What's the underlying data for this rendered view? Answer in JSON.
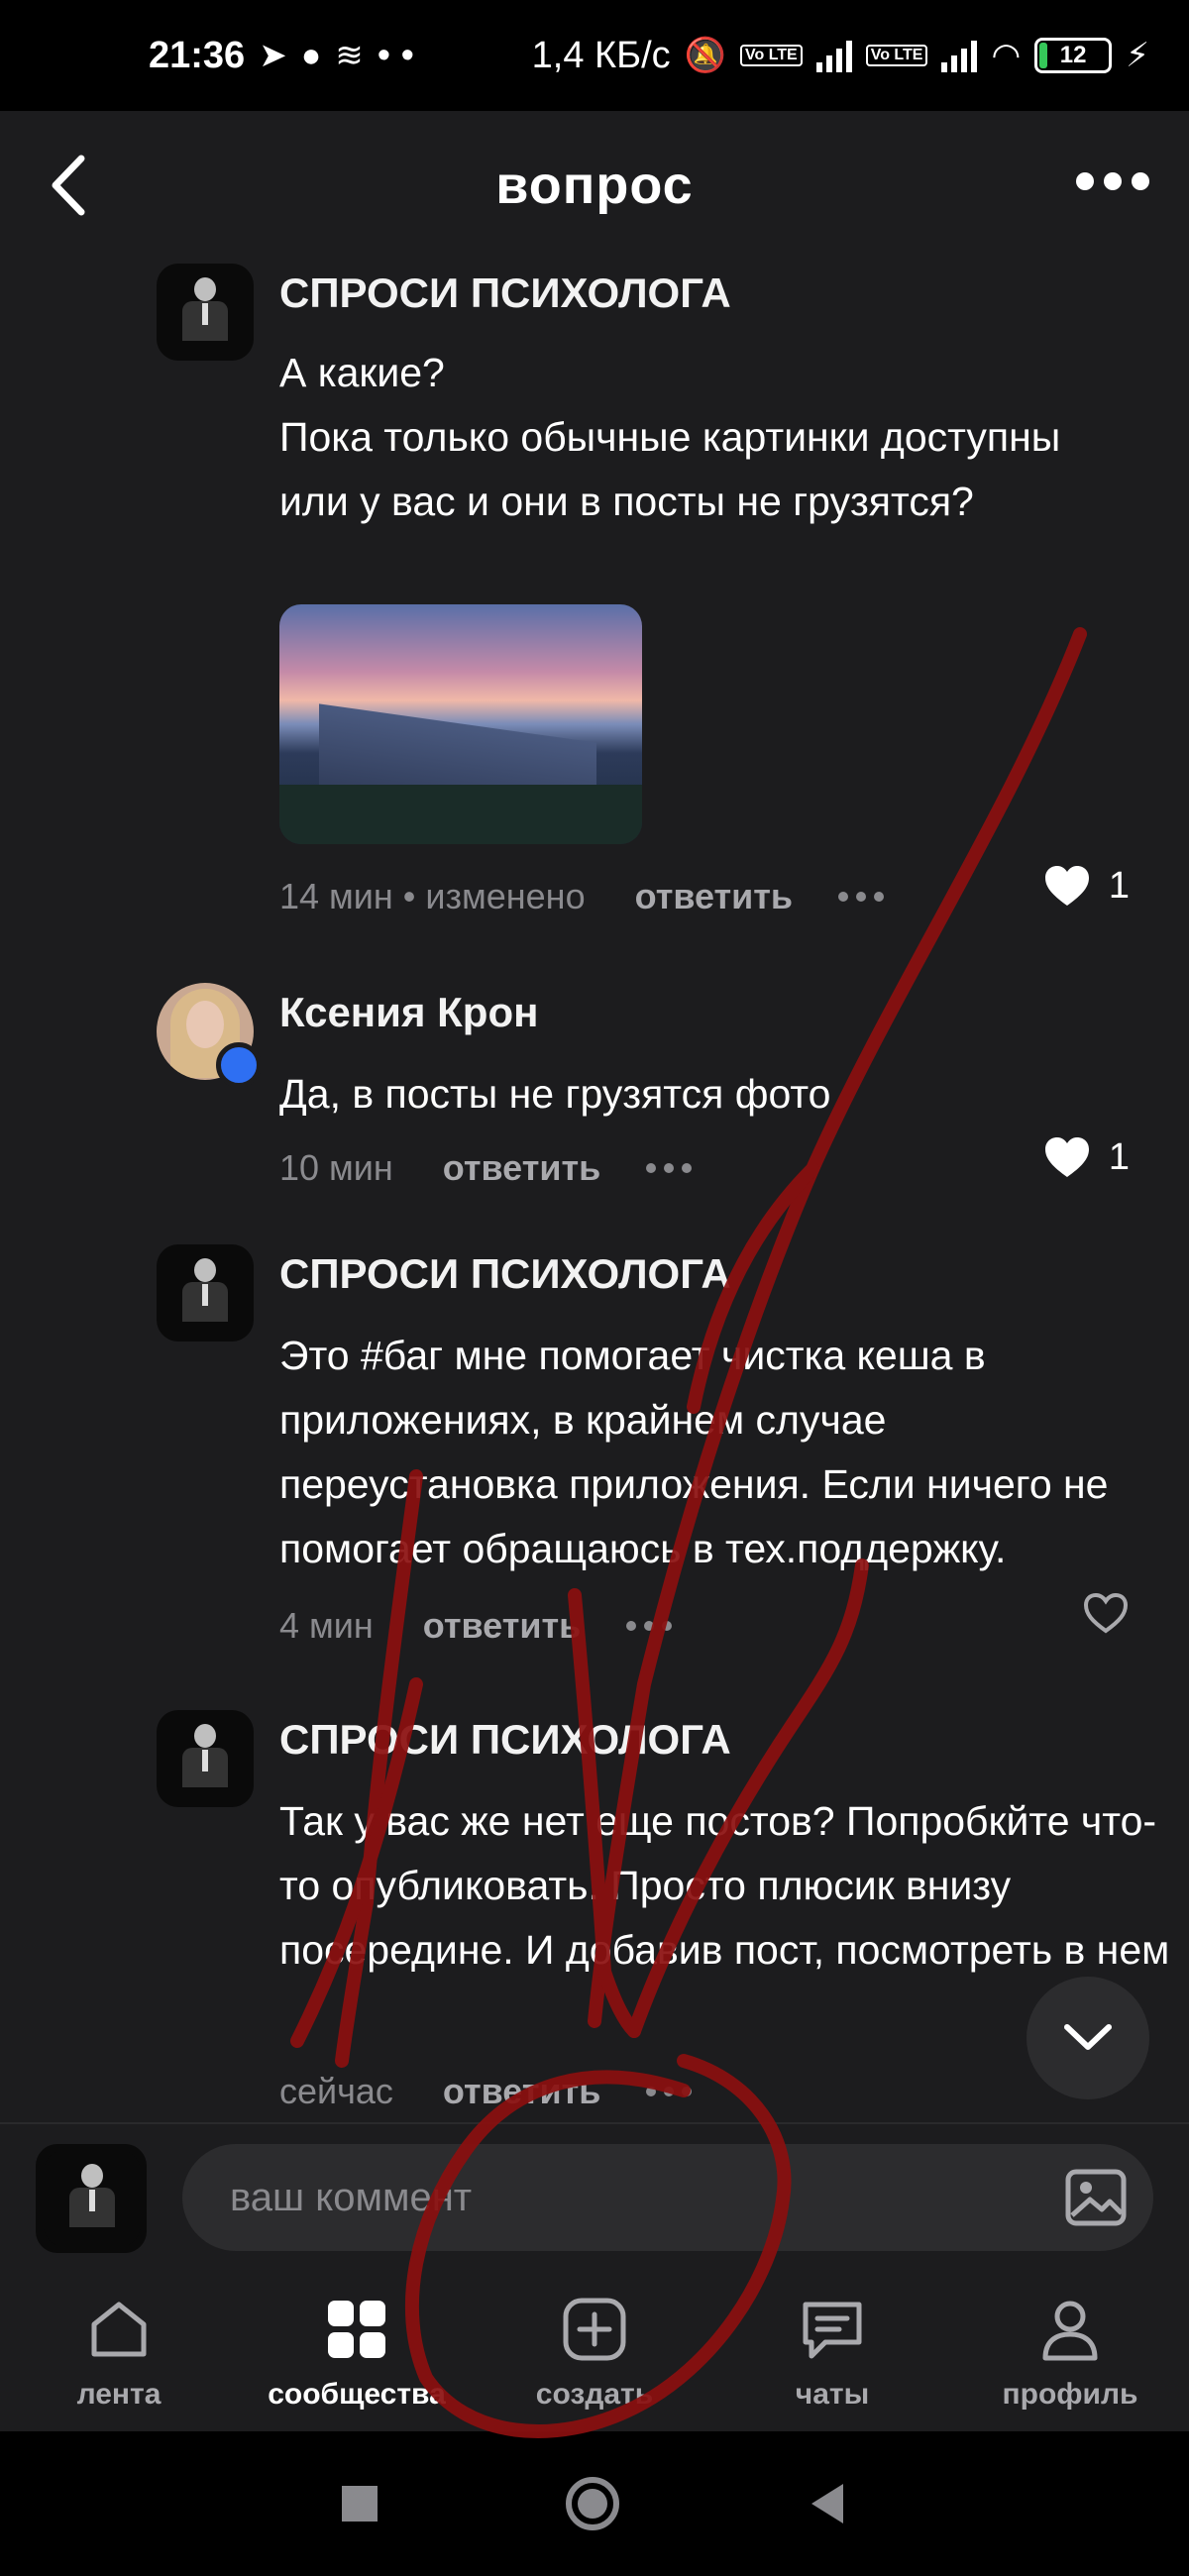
{
  "status": {
    "time": "21:36",
    "notif_dots": "• •",
    "speed": "1,4 КБ/с",
    "volte_1": "Vo LTE",
    "volte_2": "Vo LTE",
    "battery": "12",
    "battery_fraction": 0.12
  },
  "header": {
    "title": "вопрос"
  },
  "comments": [
    {
      "author": "СПРОСИ ПСИХОЛОГА",
      "text": "А какие?\nПока только обычные картинки доступны или у вас и они в посты не грузятся?",
      "time": "14 мин • изменено",
      "reply": "ответить",
      "likes": "1"
    },
    {
      "author": "Ксения Крон",
      "text": "Да, в посты не грузятся фото",
      "time": "10 мин",
      "reply": "ответить",
      "likes": "1"
    },
    {
      "author": "СПРОСИ ПСИХОЛОГА",
      "text": "Это #баг  мне помогает чистка кеша в приложениях, в крайнем случае переустановка приложения. Если ничего не помогает обращаюсь в тех.поддержку.",
      "time": "4 мин",
      "reply": "ответить"
    },
    {
      "author": "СПРОСИ ПСИХОЛОГА",
      "text": "Так у вас же нет еще постов? Попробкйте что-то опубликовать. Просто плюсик внизу посередине. И добавив пост, посмотреть в нем",
      "time": "сейчас",
      "reply": "ответить"
    }
  ],
  "composer": {
    "placeholder": "ваш коммент"
  },
  "tabs": [
    {
      "label": "лента",
      "icon": "home-icon"
    },
    {
      "label": "сообщества",
      "icon": "grid-icon"
    },
    {
      "label": "создать",
      "icon": "plus-square-icon"
    },
    {
      "label": "чаты",
      "icon": "chat-icon"
    },
    {
      "label": "профиль",
      "icon": "user-icon"
    }
  ],
  "colors": {
    "background": "#1c1c1e",
    "annotation": "#8b0f0f",
    "verified_badge": "#2e6ff2"
  }
}
